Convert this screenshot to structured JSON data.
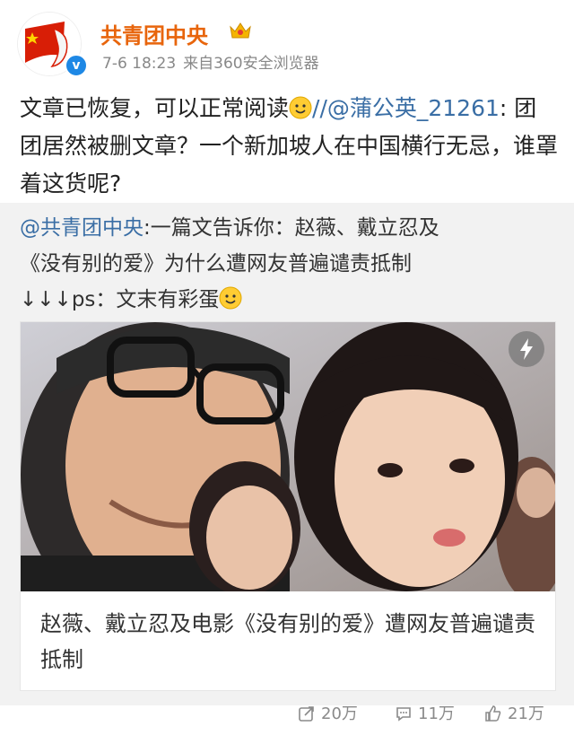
{
  "post": {
    "username": "共青团中央",
    "timestamp": "7-6 18:23",
    "source": "来自360安全浏览器",
    "text_before_mention": "文章已恢复，可以正常阅读",
    "mention": "//@蒲公英_21261",
    "text_after_mention": ": 团团居然被删文章？一个新加坡人在中国横行无忌，谁罩着这货呢?"
  },
  "repost": {
    "mention": "@共青团中央",
    "text_line_1": ":一篇文告诉你：赵薇、戴立忍及",
    "text_line_2": "《没有别的爱》为什么遭网友普遍谴责抵制",
    "text_line_3": "↓↓↓ps：文末有彩蛋"
  },
  "card": {
    "title": "赵薇、戴立忍及电影《没有别的爱》遭网友普遍谴责抵制"
  },
  "actions": {
    "repost_count": "20万",
    "comment_count": "11万",
    "like_count": "21万"
  },
  "colors": {
    "username": "#e8650c",
    "mention": "#3a6ea5",
    "repost_bg": "#f2f2f2"
  }
}
